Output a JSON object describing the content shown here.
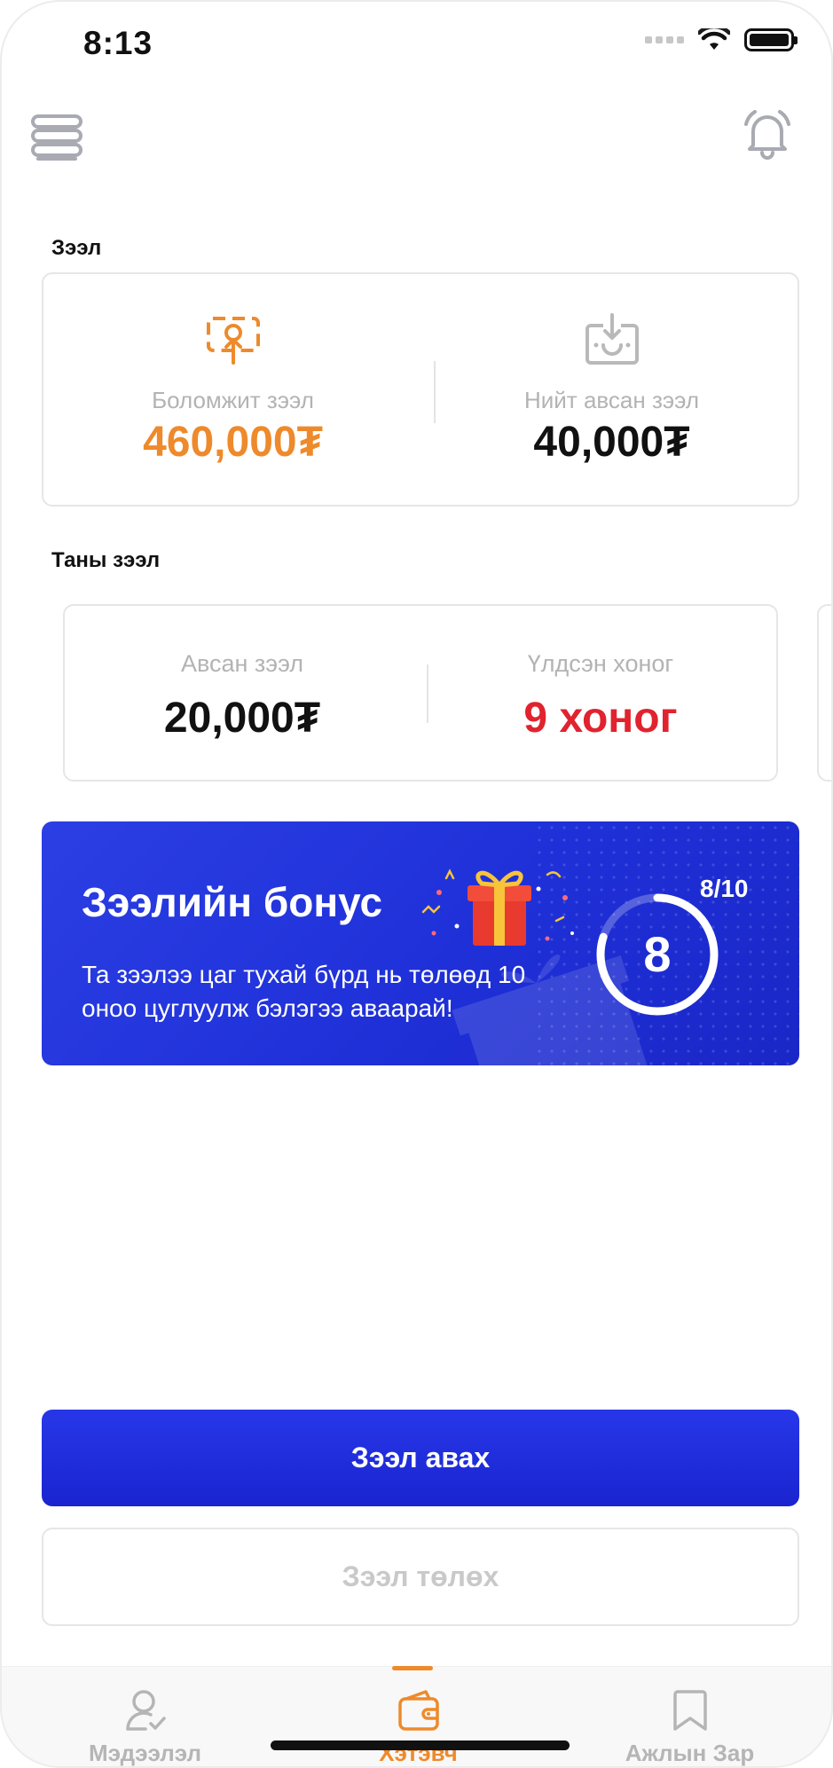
{
  "status_bar": {
    "time": "8:13"
  },
  "sections": {
    "loan": "Зээл",
    "your_loan": "Таны зээл"
  },
  "loan_summary": {
    "available_caption": "Боломжит зээл",
    "available_amount": "460,000₮",
    "total_caption": "Нийт авсан зээл",
    "total_amount": "40,000₮"
  },
  "your_loan": {
    "taken_caption": "Авсан зээл",
    "taken_amount": "20,000₮",
    "days_caption": "Үлдсэн хоног",
    "days_value": "9 хоног"
  },
  "bonus": {
    "title": "Зээлийн бонус",
    "description": "Та зээлээ цаг тухай бүрд нь төлөөд 10 оноо цуглуулж бэлэгээ аваарай!",
    "progress_label": "8/10",
    "progress_current": "8",
    "progress_fraction": 0.8
  },
  "actions": {
    "take_loan": "Зээл авах",
    "pay_loan": "Зээл төлөх"
  },
  "bottom_nav": {
    "items": [
      {
        "label": "Мэдээлэл",
        "icon": "user-check-icon"
      },
      {
        "label": "Хэтэвч",
        "icon": "wallet-icon"
      },
      {
        "label": "Ажлын Зар",
        "icon": "bookmark-icon"
      }
    ],
    "active_index": 1
  },
  "colors": {
    "accent": "#ee8a2b",
    "primary": "#1f30d8",
    "danger": "#e1232f"
  }
}
